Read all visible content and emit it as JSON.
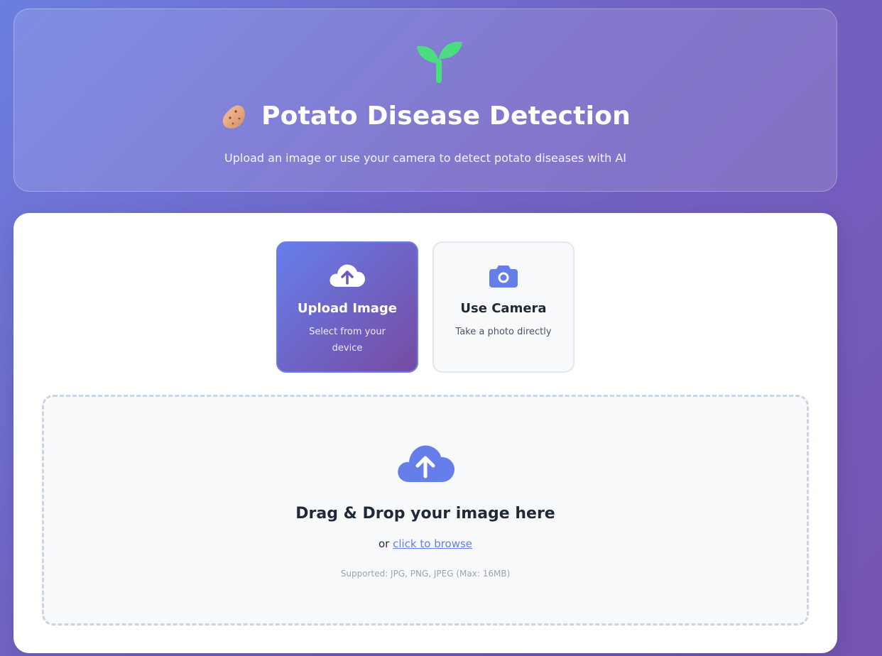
{
  "header": {
    "title": "Potato Disease Detection",
    "subtitle": "Upload an image or use your camera to detect potato diseases with AI",
    "logo_icon": "sprout-icon",
    "title_icon": "potato-emoji-icon"
  },
  "modes": [
    {
      "title": "Upload Image",
      "description": "Select from your device",
      "icon": "cloud-upload-icon",
      "active": true
    },
    {
      "title": "Use Camera",
      "description": "Take a photo directly",
      "icon": "camera-icon",
      "active": false
    }
  ],
  "dropzone": {
    "title": "Drag & Drop your image here",
    "or_text": "or",
    "browse_link": "click to browse",
    "supported": "Supported: JPG, PNG, JPEG (Max: 16MB)",
    "icon": "cloud-upload-icon"
  },
  "colors": {
    "accent": "#667eea",
    "accent_dark": "#764ba2",
    "sprout_green": "#4ade80"
  }
}
